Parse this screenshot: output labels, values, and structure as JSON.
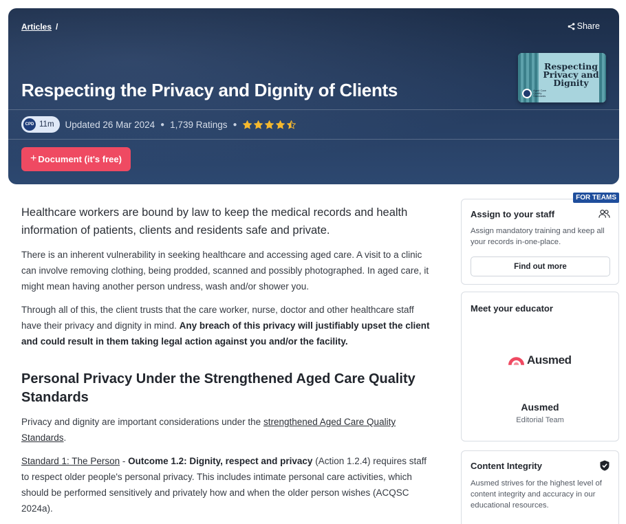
{
  "hero": {
    "breadcrumb_link": "Articles",
    "breadcrumb_sep": "/",
    "share_label": "Share",
    "title": "Respecting the Privacy and Dignity of Clients",
    "thumbnail_text": "Respecting Privacy and Dignity",
    "thumbnail_badge_text": "Aged Care Quality Standards",
    "cpd_badge": "CPD",
    "duration": "11m",
    "updated": "Updated 26 Mar 2024",
    "ratings": "1,739 Ratings",
    "rating_value": 4.5,
    "cta_label": "Document (it's free)"
  },
  "article": {
    "lead": "Healthcare workers are bound by law to keep the medical records and health information of patients, clients and residents safe and private.",
    "p1": "There is an inherent vulnerability in seeking healthcare and accessing aged care. A visit to a clinic can involve removing clothing, being prodded, scanned and possibly photographed. In aged care, it might mean having another person undress, wash and/or shower you.",
    "p2_start": "Through all of this, the client trusts that the care worker, nurse, doctor and other healthcare staff have their privacy and dignity in mind. ",
    "p2_bold": "Any breach of this privacy will justifiably upset the client and could result in them taking legal action against you and/or the facility.",
    "h2": "Personal Privacy Under the Strengthened Aged Care Quality Standards",
    "p3_start": "Privacy and dignity are important considerations under the ",
    "p3_link": "strengthened Aged Care Quality Standards",
    "p3_end": ".",
    "p4_link": "Standard 1: The Person",
    "p4_dash": " - ",
    "p4_bold": "Outcome 1.2: Dignity, respect and privacy",
    "p4_rest": " (Action 1.2.4) requires staff to respect older people's personal privacy. This includes intimate personal care activities, which should be performed sensitively and privately how and when the older person wishes (ACQSC 2024a)."
  },
  "sidebar": {
    "teams_tag": "FOR TEAMS",
    "assign_title": "Assign to your staff",
    "assign_desc": "Assign mandatory training and keep all your records in-one-place.",
    "assign_button": "Find out more",
    "educator_title": "Meet your educator",
    "logo_word": "Ausmed",
    "educator_name": "Ausmed",
    "educator_role": "Editorial Team",
    "integrity_title": "Content Integrity",
    "integrity_desc": "Ausmed strives for the highest level of content integrity and accuracy in our educational resources."
  },
  "colors": {
    "hero_bg": "#243a5c",
    "cta": "#ef4a62",
    "star": "#f5b82e",
    "tag": "#1f4e9c",
    "logo_accent": "#ef4a62"
  },
  "icons": [
    "share-icon",
    "star-icon",
    "people-icon",
    "shield-check-icon",
    "ausmed-logo-mark"
  ]
}
